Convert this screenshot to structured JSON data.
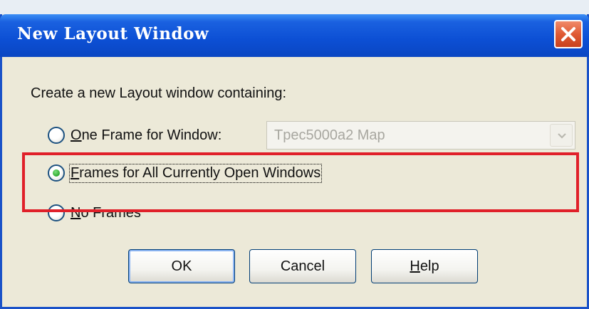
{
  "window": {
    "title": "New Layout Window"
  },
  "prompt": "Create a new Layout window containing:",
  "options": [
    {
      "mnemonic": "O",
      "rest": "ne Frame for Window:",
      "selected": false
    },
    {
      "mnemonic": "F",
      "rest": "rames for All Currently Open Windows",
      "selected": true
    },
    {
      "mnemonic": "N",
      "rest": "o Frames",
      "selected": false
    }
  ],
  "window_select": {
    "value": "Tpec5000a2 Map",
    "enabled": false
  },
  "buttons": {
    "ok": "OK",
    "cancel": "Cancel",
    "help_mnemonic": "H",
    "help_rest": "elp"
  },
  "icons": {
    "close": "close-icon",
    "dropdown": "chevron-down-icon"
  },
  "colors": {
    "title_bar": "#0c4fd4",
    "close_button": "#e05a34",
    "highlight_box": "#e02029",
    "dialog_face": "#ece9d8",
    "radio_selected": "#2fa82f"
  }
}
